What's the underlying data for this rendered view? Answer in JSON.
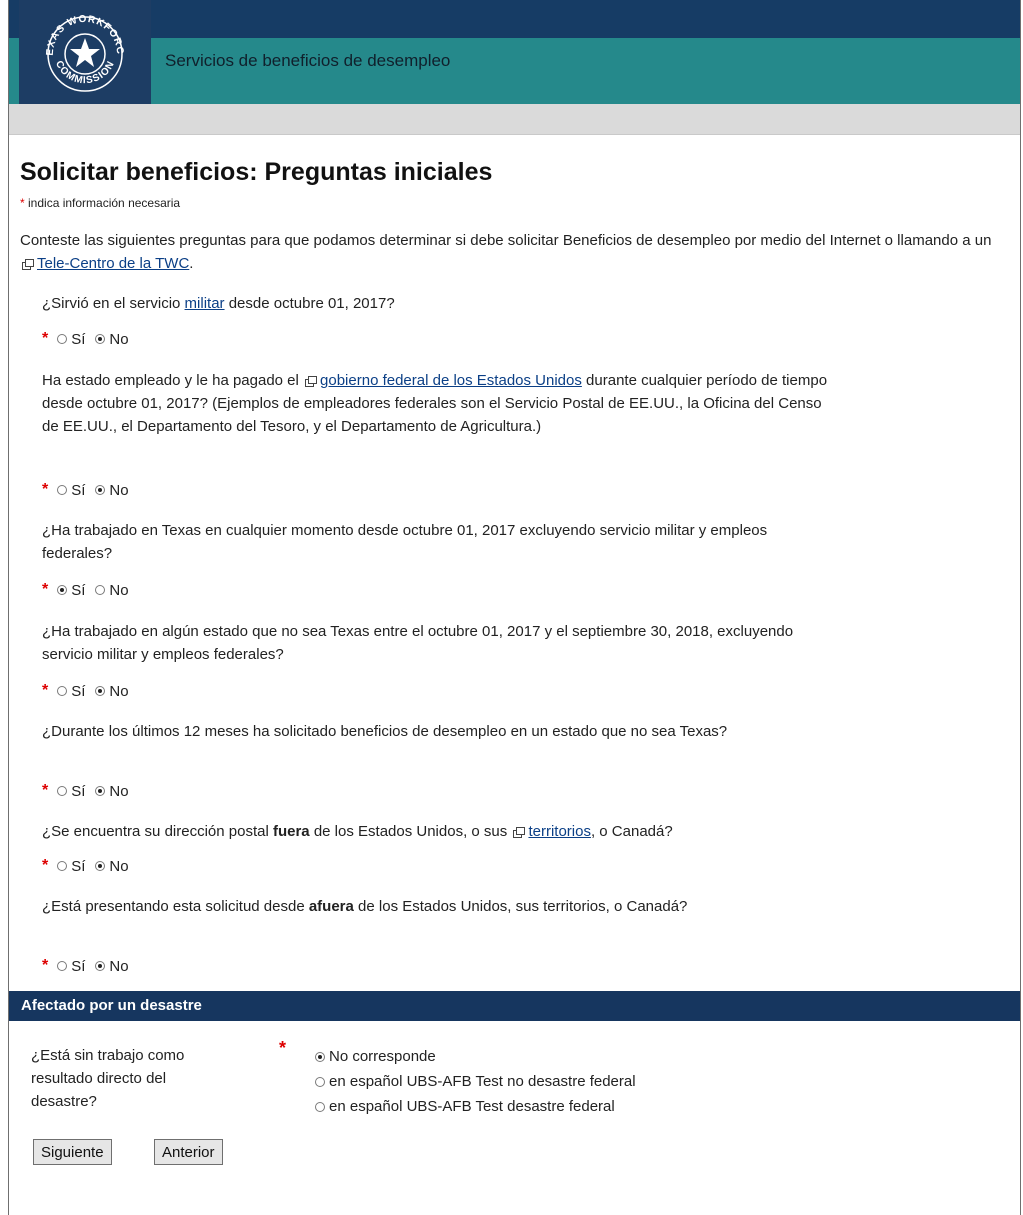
{
  "header": {
    "title": "Servicios de beneficios de desempleo",
    "logo_text": "TEXAS WORKFORCE COMMISSION"
  },
  "page": {
    "title": "Solicitar beneficios: Preguntas iniciales",
    "required_star": "*",
    "required_note": "indica información necesaria",
    "intro_text": "Conteste las siguientes preguntas para que podamos determinar si debe solicitar Beneficios de desempleo por medio del Internet o llamando a un",
    "intro_link": "Tele-Centro de la TWC",
    "intro_end": "."
  },
  "options": {
    "yes": "Sí",
    "no": "No"
  },
  "questions": {
    "q1": {
      "before": "¿Sirvió en el servicio ",
      "link": "militar",
      "after": " desde octubre 01, 2017?",
      "answer": "No"
    },
    "q2": {
      "before": "Ha estado empleado y le ha pagado el ",
      "link": "gobierno federal de los Estados Unidos",
      "after": " durante cualquier período de tiempo desde octubre 01, 2017? (Ejemplos de empleadores federales son el Servicio Postal de EE.UU., la Oficina del Censo de EE.UU., el Departamento del Tesoro, y el Departamento de Agricultura.)",
      "answer": "No"
    },
    "q3": {
      "text": "¿Ha trabajado en Texas en cualquier momento desde octubre 01, 2017 excluyendo servicio militar y empleos federales?",
      "answer": "Sí"
    },
    "q4": {
      "text": "¿Ha trabajado en algún estado que no sea Texas entre el octubre 01, 2017 y el septiembre 30, 2018, excluyendo servicio militar y empleos federales?",
      "answer": "No"
    },
    "q5": {
      "text": "¿Durante los últimos 12 meses ha solicitado beneficios de desempleo en un estado que no sea Texas?",
      "answer": "No"
    },
    "q6": {
      "before": "¿Se encuentra su dirección postal ",
      "bold": "fuera",
      "middle": " de los Estados Unidos, o sus ",
      "link": "territorios",
      "after": ", o Canadá?",
      "answer": "No"
    },
    "q7": {
      "before": "¿Está presentando esta solicitud desde ",
      "bold": "afuera",
      "after": " de los Estados Unidos, sus territorios, o Canadá?",
      "answer": "No"
    }
  },
  "disaster": {
    "section_title": "Afectado por un desastre",
    "question": "¿Está sin trabajo como resultado directo del desastre?",
    "options": [
      "No corresponde",
      "en español UBS-AFB Test no desastre federal",
      "en español UBS-AFB Test desastre federal"
    ],
    "selected": "No corresponde"
  },
  "buttons": {
    "next": "Siguiente",
    "prev": "Anterior"
  }
}
